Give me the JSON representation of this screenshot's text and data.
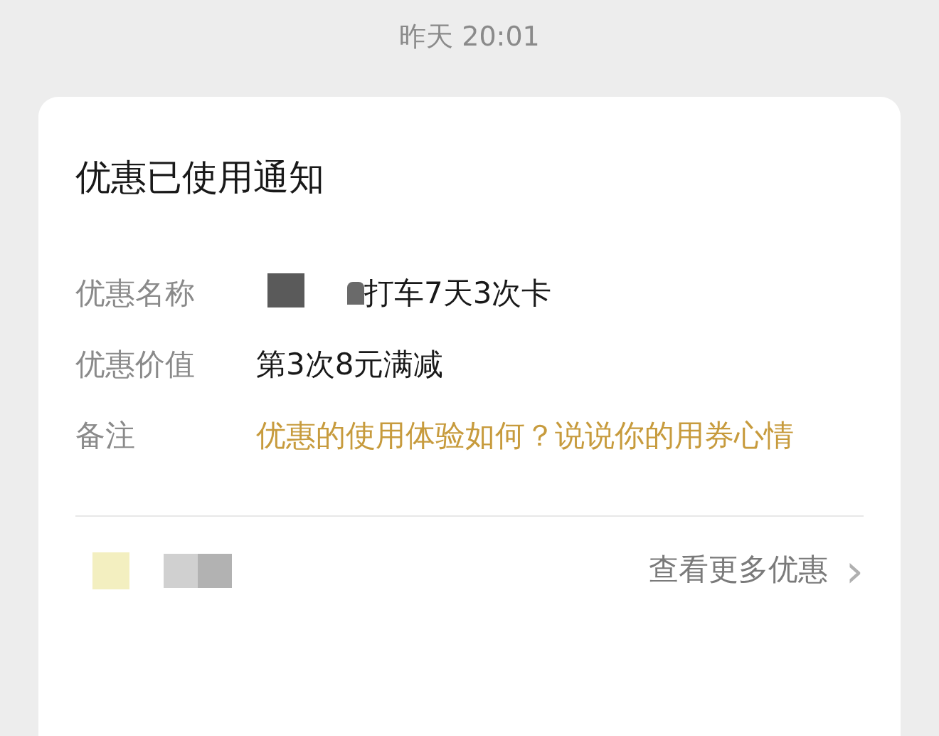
{
  "timestamp": "昨天 20:01",
  "card": {
    "title": "优惠已使用通知",
    "rows": [
      {
        "label": "优惠名称",
        "value": "打车7天3次卡",
        "kind": "redacted"
      },
      {
        "label": "优惠价值",
        "value": "第3次8元满减",
        "kind": "plain"
      },
      {
        "label": "备注",
        "value": "优惠的使用体验如何？说说你的用券心情",
        "kind": "highlight"
      }
    ],
    "footer": {
      "link": "查看更多优惠",
      "chevron": "›"
    }
  }
}
